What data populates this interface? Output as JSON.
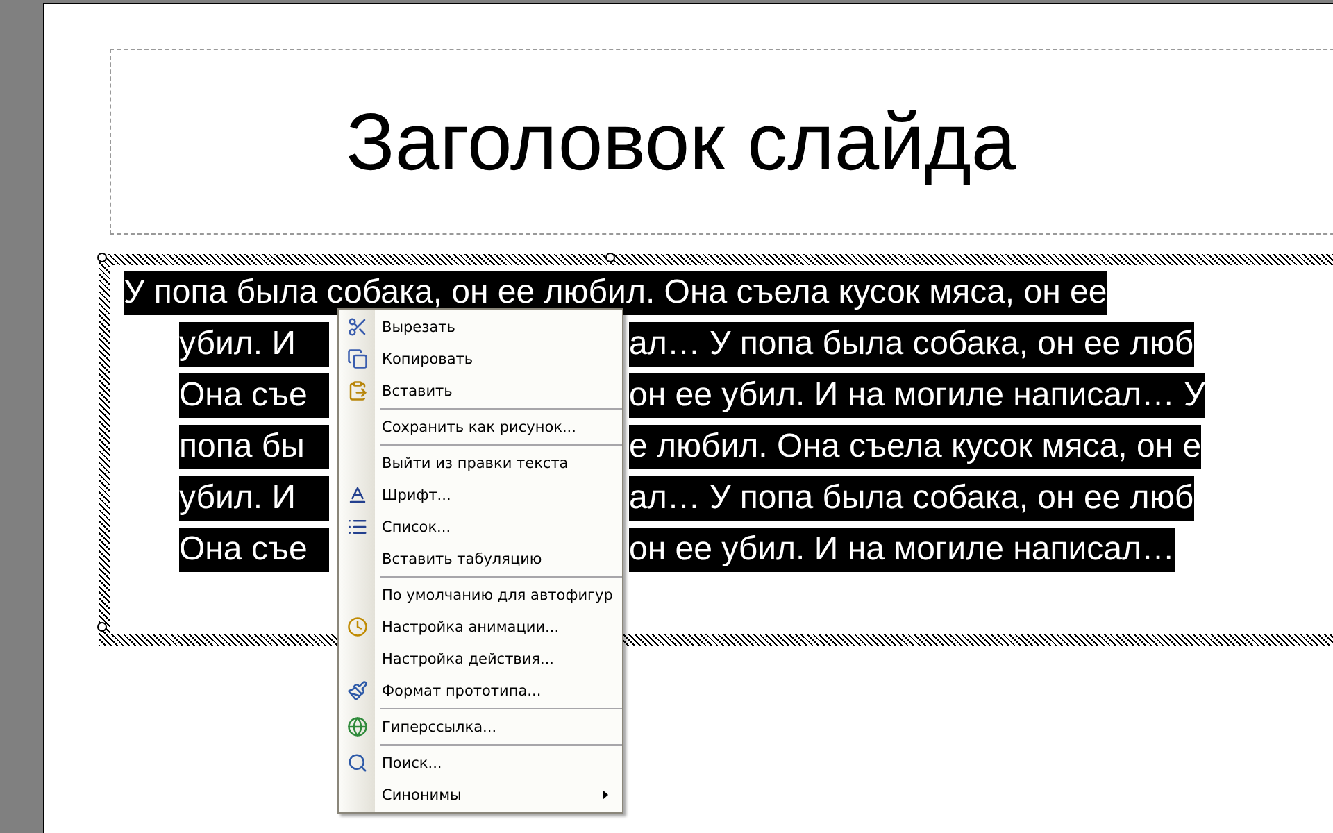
{
  "slide": {
    "title": "Заголовок слайда",
    "body_lines": [
      {
        "segments": [
          "У попа была собака, он ее любил. Она съела кусок мяса, он ее"
        ]
      },
      {
        "segments": [
          "убил. И",
          "ал… У попа была собака, он ее люб"
        ]
      },
      {
        "segments": [
          "Она съе",
          "он ее убил. И на могиле написал… У"
        ]
      },
      {
        "segments": [
          "попа бы",
          "е любил. Она съела кусок мяса, он е"
        ]
      },
      {
        "segments": [
          "убил. И",
          "ал… У попа была собака, он ее люб"
        ]
      },
      {
        "segments": [
          "Она съе",
          "он ее убил. И на могиле написал…"
        ]
      }
    ]
  },
  "context_menu": {
    "groups": [
      [
        {
          "label": "Вырезать",
          "icon": true,
          "submenu": false
        },
        {
          "label": "Копировать",
          "icon": true,
          "submenu": false
        },
        {
          "label": "Вставить",
          "icon": true,
          "submenu": false
        }
      ],
      [
        {
          "label": "Сохранить как рисунок...",
          "icon": false,
          "submenu": false
        }
      ],
      [
        {
          "label": "Выйти из правки текста",
          "icon": false,
          "submenu": false
        },
        {
          "label": "Шрифт...",
          "icon": true,
          "submenu": false
        },
        {
          "label": "Список...",
          "icon": true,
          "submenu": false
        },
        {
          "label": "Вставить табуляцию",
          "icon": false,
          "submenu": false
        }
      ],
      [
        {
          "label": "По умолчанию для автофигур",
          "icon": false,
          "submenu": false
        },
        {
          "label": "Настройка анимации...",
          "icon": true,
          "submenu": false
        },
        {
          "label": "Настройка действия...",
          "icon": false,
          "submenu": false
        },
        {
          "label": "Формат прототипа...",
          "icon": true,
          "submenu": false
        }
      ],
      [
        {
          "label": "Гиперссылка...",
          "icon": true,
          "submenu": false
        }
      ],
      [
        {
          "label": "Поиск...",
          "icon": true,
          "submenu": false
        },
        {
          "label": "Синонимы",
          "icon": false,
          "submenu": true
        }
      ]
    ]
  }
}
